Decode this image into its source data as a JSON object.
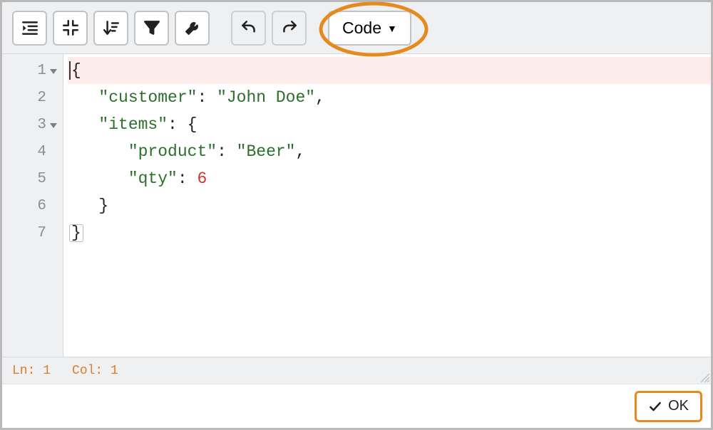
{
  "toolbar": {
    "dropdown_label": "Code"
  },
  "editor": {
    "lines": [
      {
        "n": "1",
        "foldable": true,
        "active": true,
        "indent": 0,
        "tokens": [
          {
            "t": "punc",
            "v": "{",
            "cursor": true,
            "match": false
          }
        ]
      },
      {
        "n": "2",
        "foldable": false,
        "active": false,
        "indent": 1,
        "tokens": [
          {
            "t": "key",
            "v": "\"customer\""
          },
          {
            "t": "punc",
            "v": ": "
          },
          {
            "t": "str",
            "v": "\"John Doe\""
          },
          {
            "t": "punc",
            "v": ","
          }
        ]
      },
      {
        "n": "3",
        "foldable": true,
        "active": false,
        "indent": 1,
        "tokens": [
          {
            "t": "key",
            "v": "\"items\""
          },
          {
            "t": "punc",
            "v": ": "
          },
          {
            "t": "punc",
            "v": "{"
          }
        ]
      },
      {
        "n": "4",
        "foldable": false,
        "active": false,
        "indent": 2,
        "tokens": [
          {
            "t": "key",
            "v": "\"product\""
          },
          {
            "t": "punc",
            "v": ": "
          },
          {
            "t": "str",
            "v": "\"Beer\""
          },
          {
            "t": "punc",
            "v": ","
          }
        ]
      },
      {
        "n": "5",
        "foldable": false,
        "active": false,
        "indent": 2,
        "tokens": [
          {
            "t": "key",
            "v": "\"qty\""
          },
          {
            "t": "punc",
            "v": ": "
          },
          {
            "t": "num",
            "v": "6"
          }
        ]
      },
      {
        "n": "6",
        "foldable": false,
        "active": false,
        "indent": 1,
        "tokens": [
          {
            "t": "punc",
            "v": "}"
          }
        ]
      },
      {
        "n": "7",
        "foldable": false,
        "active": false,
        "indent": 0,
        "tokens": [
          {
            "t": "punc",
            "v": "}",
            "match": true
          }
        ]
      }
    ]
  },
  "status": {
    "ln_label": "Ln: 1",
    "col_label": "Col: 1"
  },
  "footer": {
    "ok_label": "OK"
  }
}
